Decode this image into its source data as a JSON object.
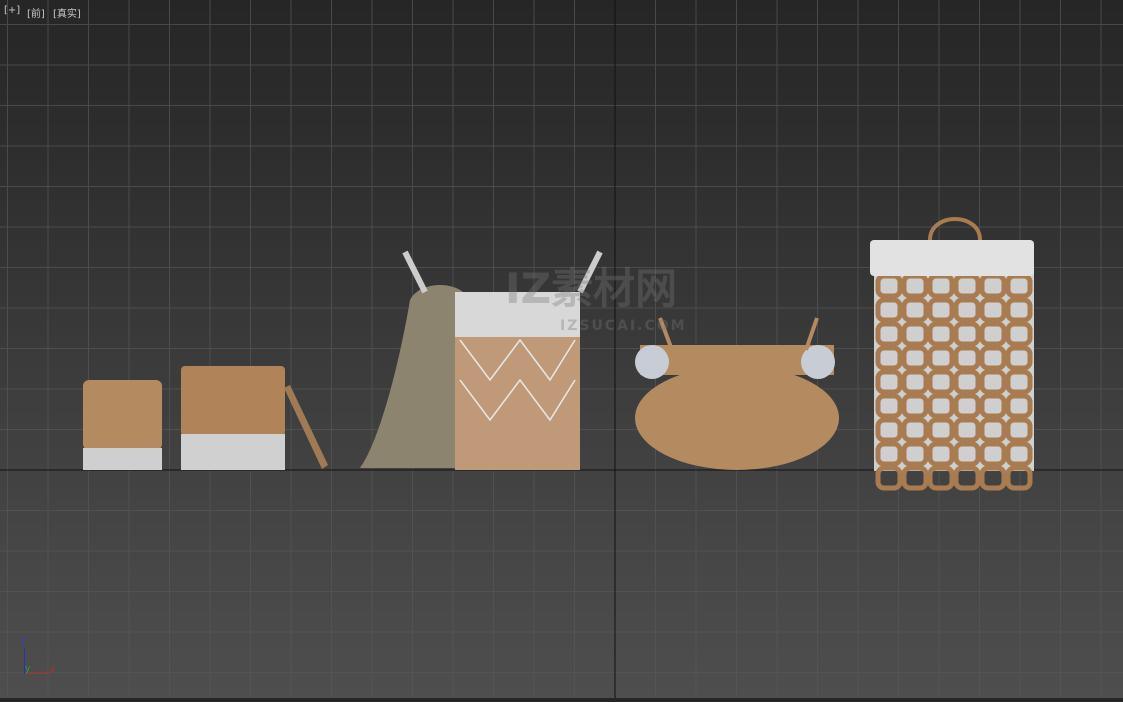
{
  "viewport": {
    "labels": {
      "plus": "[+]",
      "view": "[前]",
      "shading": "[真实]"
    },
    "gizmo": {
      "z": "z",
      "y": "y",
      "x": "x"
    },
    "watermark": {
      "brand": "IZ素材网",
      "url": "IZSUCAI.COM"
    },
    "colors": {
      "axis_x": "#b03030",
      "axis_y": "#30a030",
      "axis_z": "#2c2cc0",
      "grid": "#5a5a5a",
      "world_axis": "#111111",
      "wicker": "#b48a60",
      "white": "#d8d8d8"
    }
  }
}
